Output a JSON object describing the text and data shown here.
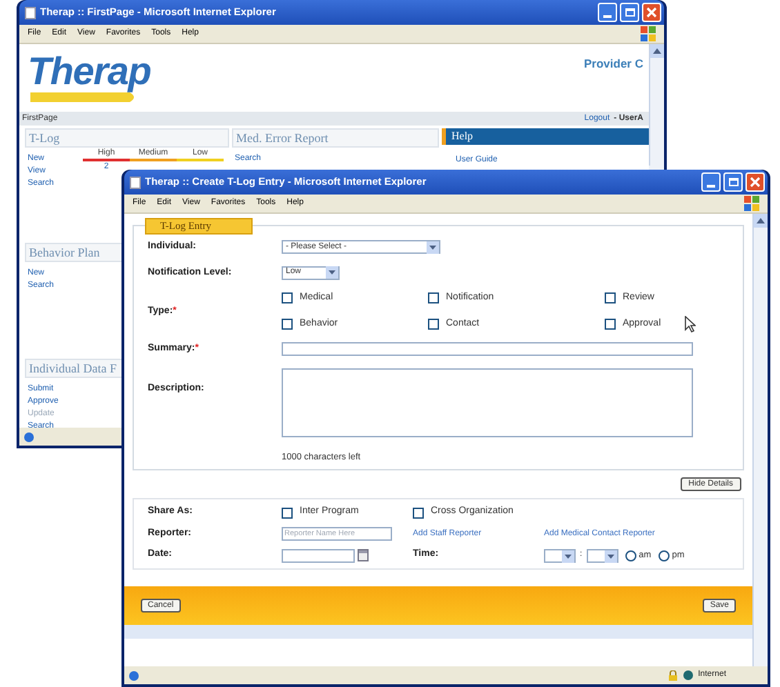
{
  "back_window": {
    "title": "Therap :: FirstPage - Microsoft Internet Explorer",
    "menu": [
      "File",
      "Edit",
      "View",
      "Favorites",
      "Tools",
      "Help"
    ],
    "logo": "Therap",
    "provider": "Provider C",
    "breadcrumb": "FirstPage",
    "logout": "Logout",
    "user": "- UserA",
    "tlog": {
      "title": "T-Log",
      "links": [
        "New",
        "View",
        "Search"
      ],
      "levels": [
        {
          "label": "High",
          "color": "#e03030",
          "count": "2"
        },
        {
          "label": "Medium",
          "color": "#f0a020"
        },
        {
          "label": "Low",
          "color": "#f0d020"
        }
      ]
    },
    "med_error": {
      "title": "Med. Error Report",
      "links": [
        "Search"
      ]
    },
    "help": {
      "title": "Help",
      "links": [
        "User Guide"
      ]
    },
    "behavior_plan": {
      "title": "Behavior Plan",
      "links": [
        "New",
        "Search"
      ]
    },
    "individual_data": {
      "title": "Individual Data F",
      "links": [
        {
          "label": "Submit",
          "disabled": false
        },
        {
          "label": "Approve",
          "disabled": false
        },
        {
          "label": "Update",
          "disabled": true
        },
        {
          "label": "Search",
          "disabled": false
        }
      ]
    }
  },
  "front_window": {
    "title": "Therap :: Create T-Log Entry - Microsoft Internet Explorer",
    "menu": [
      "File",
      "Edit",
      "View",
      "Favorites",
      "Tools",
      "Help"
    ],
    "legend": "T-Log Entry",
    "individual": {
      "label": "Individual:",
      "value": "- Please Select -"
    },
    "notification_level": {
      "label": "Notification Level:",
      "value": "Low"
    },
    "type": {
      "label": "Type:",
      "mark": "*",
      "options": [
        {
          "label": "Medical",
          "checked": false
        },
        {
          "label": "Notification",
          "checked": false
        },
        {
          "label": "Review",
          "checked": false
        },
        {
          "label": "Behavior",
          "checked": false
        },
        {
          "label": "Contact",
          "checked": false
        },
        {
          "label": "Approval",
          "checked": false
        }
      ]
    },
    "summary": {
      "label": "Summary:",
      "mark": "*"
    },
    "description": {
      "label": "Description:",
      "counter": "1000 characters left"
    },
    "hide_details": "Hide Details",
    "share_as": {
      "label": "Share As:",
      "options": [
        {
          "label": "Inter Program",
          "checked": false
        },
        {
          "label": "Cross Organization",
          "checked": false
        }
      ]
    },
    "reporter": {
      "label": "Reporter:",
      "placeholder": "Reporter Name Here",
      "links": [
        "Add Staff Reporter",
        "Add Medical Contact Reporter"
      ]
    },
    "date": {
      "label": "Date:"
    },
    "time": {
      "label": "Time:",
      "separator": ":",
      "periods": [
        {
          "label": "am",
          "selected": false
        },
        {
          "label": "pm",
          "selected": false
        }
      ]
    },
    "buttons": {
      "cancel": "Cancel",
      "save": "Save"
    },
    "status": "Internet"
  }
}
